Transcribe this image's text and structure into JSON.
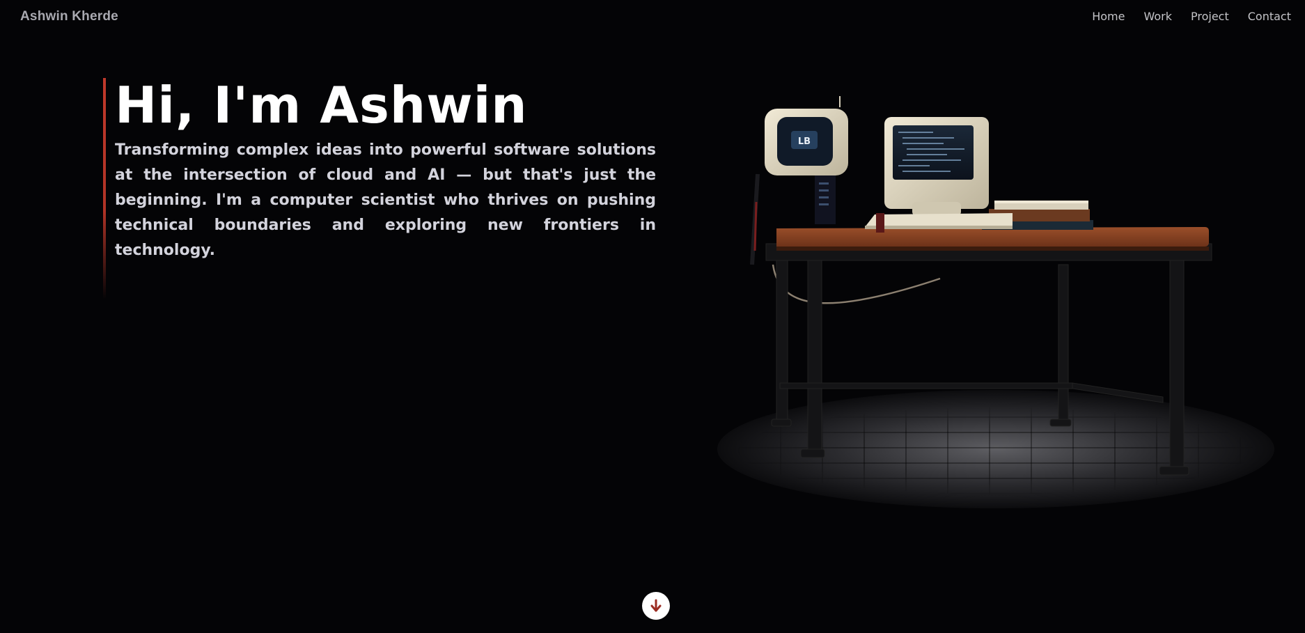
{
  "nav": {
    "brand": "Ashwin Kherde",
    "links": [
      "Home",
      "Work",
      "Project",
      "Contact"
    ]
  },
  "hero": {
    "title": "Hi, I'm Ashwin",
    "text": "Transforming complex ideas into powerful software solutions at the intersection of cloud and AI — but that's just the beginning. I'm a computer scientist who thrives on pushing technical boundaries and exploring new frontiers in technology."
  },
  "illustration": {
    "monitor_badge": "LB"
  },
  "colors": {
    "background": "#040406",
    "accent": "#c0392b",
    "desk_top": "#8a4424",
    "monitor_beige": "#e9e2cc"
  },
  "icons": {
    "scroll_down": "arrow-down-icon"
  }
}
